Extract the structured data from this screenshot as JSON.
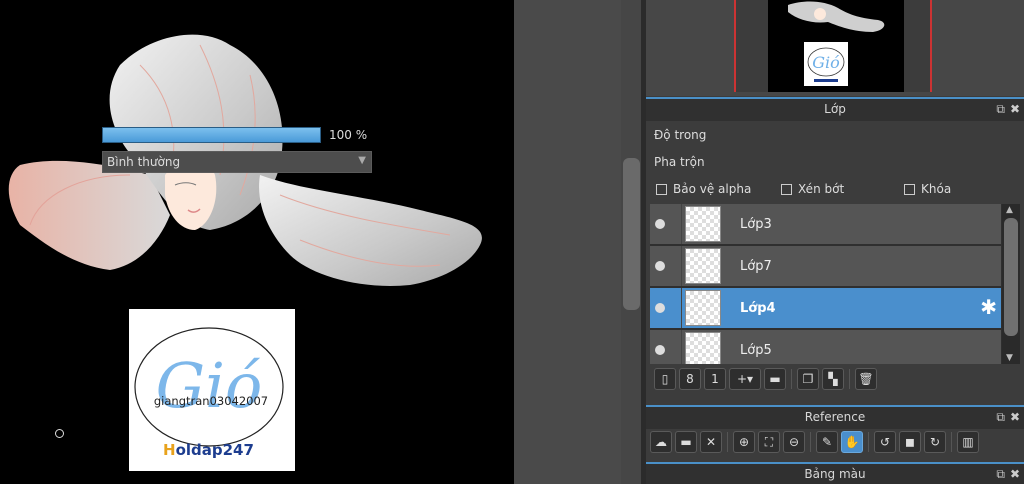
{
  "canvas": {
    "logo": {
      "script_text": "Gió",
      "handle_text": "giangtran03042007",
      "brand_prefix": "H",
      "brand_rest": "oldap247"
    }
  },
  "layer_panel": {
    "title": "Lớp",
    "opacity_label": "Độ trong",
    "opacity_value": "100 %",
    "opacity_percent": 100,
    "blend_label": "Pha trộn",
    "blend_value": "Bình thường",
    "protect_alpha": "Bảo vệ alpha",
    "clipping": "Xén bớt",
    "lock": "Khóa",
    "layers": [
      {
        "name": "Lớp3",
        "selected": false
      },
      {
        "name": "Lớp7",
        "selected": false
      },
      {
        "name": "Lớp4",
        "selected": true
      },
      {
        "name": "Lớp5",
        "selected": false
      }
    ],
    "toolbar_icons": [
      "new-layer-icon",
      "new-raster-icon",
      "new-8bit-icon",
      "add-layer-dropdown-icon",
      "folder-icon",
      "duplicate-icon",
      "merge-down-icon",
      "delete-icon"
    ]
  },
  "reference_panel": {
    "title": "Reference",
    "toolbar_icons": [
      "upload-icon",
      "open-folder-icon",
      "close-icon",
      "zoom-in-icon",
      "fit-icon",
      "zoom-out-icon",
      "eyedropper-icon",
      "hand-icon",
      "rotate-left-icon",
      "reset-icon",
      "rotate-right-icon",
      "share-icon"
    ]
  },
  "palette_panel": {
    "title": "Bảng màu"
  },
  "colors": {
    "accent": "#4a8fcd",
    "panel_bg": "#3c3c3c",
    "header_bg": "#303030",
    "nav_frame": "#cc3333"
  }
}
